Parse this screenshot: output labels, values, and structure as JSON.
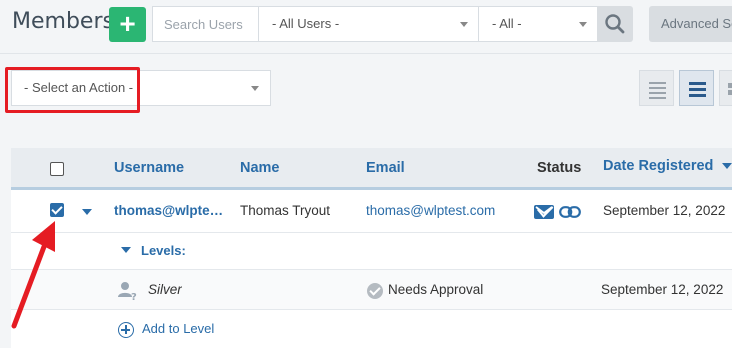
{
  "header": {
    "title": "Members",
    "add_label": "+",
    "search_placeholder": "Search Users",
    "user_filter": "- All Users -",
    "status_filter": "- All -",
    "advanced_label": "Advanced Se"
  },
  "actions": {
    "select_label": "- Select an Action -"
  },
  "table": {
    "columns": {
      "username": "Username",
      "name": "Name",
      "email": "Email",
      "status": "Status",
      "date_registered": "Date Registered"
    },
    "member": {
      "username": "thomas@wlptest.com",
      "username_display": "thomas@wlpte…",
      "name": "Thomas Tryout",
      "email": "thomas@wlptest.com",
      "date_registered": "September 12, 2022",
      "checked": true
    },
    "levels_label": "Levels:",
    "level": {
      "name": "Silver",
      "status": "Needs Approval",
      "date": "September 12, 2022"
    },
    "add_level_label": "Add to Level"
  },
  "colors": {
    "accent": "#2a6ca8",
    "add_button": "#2bb673",
    "annotation": "#e51c23"
  }
}
